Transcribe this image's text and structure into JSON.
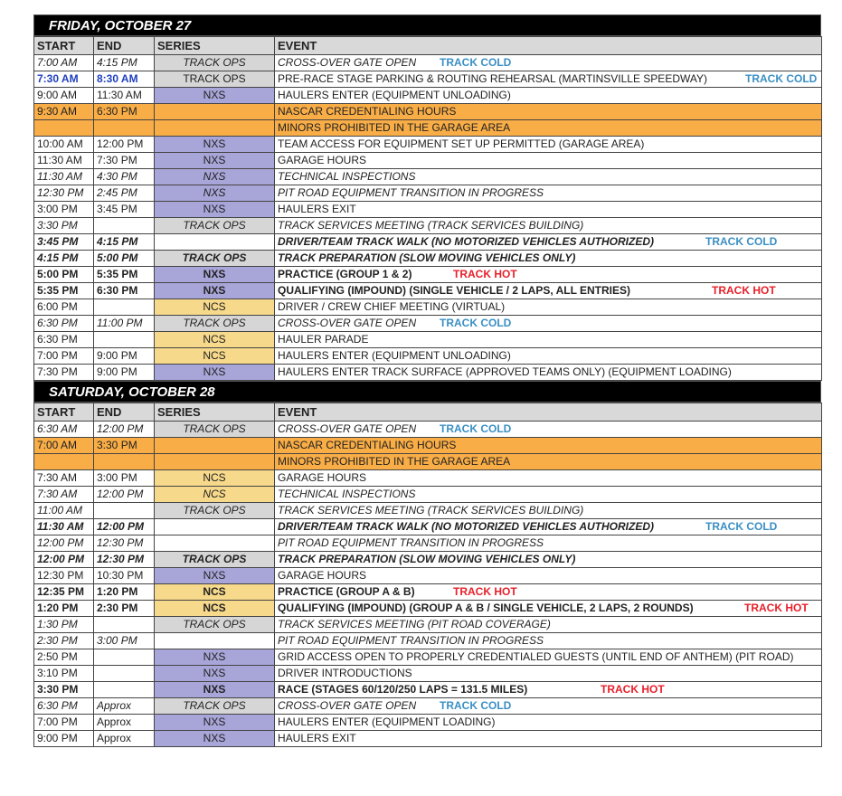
{
  "columns": {
    "start": "START",
    "end": "END",
    "series": "SERIES",
    "event": "EVENT"
  },
  "colors": {
    "track_cold": "#3a8fc4",
    "track_hot": "#e8202a",
    "credential_orange": "#f9ad46",
    "track_ops_gray": "#d6d6d6",
    "nxs_purple": "#a8a5d8",
    "ncs_yellow": "#f7d98b",
    "header_black": "#000000"
  },
  "days": [
    {
      "title": "FRIDAY, OCTOBER 27",
      "rows": [
        {
          "start": "7:00 AM",
          "end": "4:15 PM",
          "series": "TRACK OPS",
          "event": "CROSS-OVER GATE OPEN",
          "tag": "TRACK COLD",
          "tag_offset": 182,
          "style": "italic"
        },
        {
          "start": "7:30 AM",
          "end": "8:30 AM",
          "series": "TRACK OPS",
          "event": "PRE-RACE STAGE PARKING & ROUTING REHEARSAL  (MARTINSVILLE SPEEDWAY)",
          "tag": "TRACK COLD",
          "tag_offset": 520,
          "style": "blue"
        },
        {
          "start": "9:00 AM",
          "end": "11:30 AM",
          "series": "NXS",
          "event": "HAULERS ENTER (EQUIPMENT UNLOADING)",
          "tag": "",
          "style": ""
        },
        {
          "start": "9:30 AM",
          "end": "6:30 PM",
          "series": "",
          "event": "NASCAR CREDENTIALING HOURS",
          "tag": "",
          "style": "orange"
        },
        {
          "start": "",
          "end": "",
          "series": "",
          "event": "MINORS PROHIBITED IN THE GARAGE AREA",
          "tag": "",
          "style": "orange"
        },
        {
          "start": "10:00 AM",
          "end": "12:00 PM",
          "series": "NXS",
          "event": "TEAM ACCESS FOR EQUIPMENT SET UP PERMITTED (GARAGE AREA)",
          "tag": "",
          "style": ""
        },
        {
          "start": "11:30 AM",
          "end": "7:30 PM",
          "series": "NXS",
          "event": "GARAGE HOURS",
          "tag": "",
          "style": ""
        },
        {
          "start": "11:30 AM",
          "end": "4:30 PM",
          "series": "NXS",
          "event": "TECHNICAL INSPECTIONS",
          "tag": "",
          "style": "italic"
        },
        {
          "start": "12:30 PM",
          "end": "2:45 PM",
          "series": "NXS",
          "event": "PIT ROAD EQUIPMENT TRANSITION IN PROGRESS",
          "tag": "",
          "style": "italic"
        },
        {
          "start": "3:00 PM",
          "end": "3:45 PM",
          "series": "NXS",
          "event": "HAULERS EXIT",
          "tag": "",
          "style": ""
        },
        {
          "start": "3:30 PM",
          "end": "",
          "series": "TRACK OPS",
          "event": "TRACK SERVICES MEETING (TRACK SERVICES BUILDING)",
          "tag": "",
          "style": "italic"
        },
        {
          "start": "3:45 PM",
          "end": "4:15 PM",
          "series": "",
          "event": "DRIVER/TEAM TRACK WALK  (NO MOTORIZED VEHICLES AUTHORIZED)",
          "tag": "TRACK COLD",
          "tag_offset": 476,
          "style": "bold italic"
        },
        {
          "start": "4:15 PM",
          "end": "5:00 PM",
          "series": "TRACK OPS",
          "event": "TRACK PREPARATION  (SLOW MOVING VEHICLES ONLY)",
          "tag": "",
          "style": "bold italic"
        },
        {
          "start": "5:00 PM",
          "end": "5:35 PM",
          "series": "NXS",
          "event": "PRACTICE (GROUP 1 & 2)",
          "tag": "TRACK HOT",
          "tag_offset": 197,
          "style": "bold"
        },
        {
          "start": "5:35 PM",
          "end": "6:30 PM",
          "series": "NXS",
          "event": "QUALIFYING (IMPOUND) (SINGLE VEHICLE / 2 LAPS, ALL ENTRIES)",
          "tag": "TRACK HOT",
          "tag_offset": 483,
          "style": "bold"
        },
        {
          "start": "6:00 PM",
          "end": "",
          "series": "NCS",
          "event": "DRIVER / CREW CHIEF MEETING (VIRTUAL)",
          "tag": "",
          "style": ""
        },
        {
          "start": "6:30 PM",
          "end": "11:00 PM",
          "series": "TRACK OPS",
          "event": "CROSS-OVER GATE OPEN",
          "tag": "TRACK COLD",
          "tag_offset": 182,
          "style": "italic"
        },
        {
          "start": "6:30 PM",
          "end": "",
          "series": "NCS",
          "event": "HAULER PARADE",
          "tag": "",
          "style": ""
        },
        {
          "start": "7:00 PM",
          "end": "9:00 PM",
          "series": "NCS",
          "event": "HAULERS ENTER (EQUIPMENT UNLOADING)",
          "tag": "",
          "style": ""
        },
        {
          "start": "7:30 PM",
          "end": "9:00 PM",
          "series": "NXS",
          "event": "HAULERS ENTER TRACK SURFACE (APPROVED TEAMS ONLY) (EQUIPMENT LOADING)",
          "tag": "",
          "style": ""
        }
      ]
    },
    {
      "title": "SATURDAY, OCTOBER 28",
      "rows": [
        {
          "start": "6:30 AM",
          "end": "12:00 PM",
          "series": "TRACK OPS",
          "event": "CROSS-OVER GATE OPEN",
          "tag": "TRACK COLD",
          "tag_offset": 182,
          "style": "italic"
        },
        {
          "start": "7:00 AM",
          "end": "3:30 PM",
          "series": "",
          "event": "NASCAR CREDENTIALING HOURS",
          "tag": "",
          "style": "orange"
        },
        {
          "start": "",
          "end": "",
          "series": "",
          "event": "MINORS PROHIBITED IN THE GARAGE AREA",
          "tag": "",
          "style": "orange"
        },
        {
          "start": "7:30 AM",
          "end": "3:00 PM",
          "series": "NCS",
          "event": "GARAGE HOURS",
          "tag": "",
          "style": ""
        },
        {
          "start": "7:30 AM",
          "end": "12:00 PM",
          "series": "NCS",
          "event": "TECHNICAL INSPECTIONS",
          "tag": "",
          "style": "italic"
        },
        {
          "start": "11:00 AM",
          "end": "",
          "series": "TRACK OPS",
          "event": "TRACK SERVICES MEETING (TRACK SERVICES BUILDING)",
          "tag": "",
          "style": "italic"
        },
        {
          "start": "11:30 AM",
          "end": "12:00 PM",
          "series": "",
          "event": "DRIVER/TEAM TRACK WALK  (NO MOTORIZED VEHICLES AUTHORIZED)",
          "tag": "TRACK COLD",
          "tag_offset": 476,
          "style": "bold italic"
        },
        {
          "start": "12:00 PM",
          "end": "12:30 PM",
          "series": "",
          "event": "PIT ROAD EQUIPMENT TRANSITION IN PROGRESS",
          "tag": "",
          "style": "italic"
        },
        {
          "start": "12:00 PM",
          "end": "12:30 PM",
          "series": "TRACK OPS",
          "event": "TRACK PREPARATION  (SLOW MOVING VEHICLES ONLY)",
          "tag": "",
          "style": "bold italic"
        },
        {
          "start": "12:30 PM",
          "end": "10:30 PM",
          "series": "NXS",
          "event": "GARAGE HOURS",
          "tag": "",
          "style": ""
        },
        {
          "start": "12:35 PM",
          "end": "1:20 PM",
          "series": "NCS",
          "event": "PRACTICE (GROUP A & B)",
          "tag": "TRACK HOT",
          "tag_offset": 197,
          "style": "bold"
        },
        {
          "start": "1:20 PM",
          "end": "2:30 PM",
          "series": "NCS",
          "event": "QUALIFYING (IMPOUND) (GROUP A & B / SINGLE VEHICLE, 2 LAPS, 2 ROUNDS)",
          "tag": "TRACK HOT",
          "tag_offset": 519,
          "style": "bold"
        },
        {
          "start": "1:30 PM",
          "end": "",
          "series": "TRACK OPS",
          "event": "TRACK SERVICES MEETING (PIT ROAD COVERAGE)",
          "tag": "",
          "style": "italic"
        },
        {
          "start": "2:30 PM",
          "end": "3:00 PM",
          "series": "",
          "event": "PIT ROAD EQUIPMENT TRANSITION IN PROGRESS",
          "tag": "",
          "style": "italic"
        },
        {
          "start": "2:50 PM",
          "end": "",
          "series": "NXS",
          "event": "GRID ACCESS OPEN TO PROPERLY CREDENTIALED GUESTS (UNTIL END OF ANTHEM) (PIT ROAD)",
          "tag": "",
          "style": ""
        },
        {
          "start": "3:10 PM",
          "end": "",
          "series": "NXS",
          "event": "DRIVER INTRODUCTIONS",
          "tag": "",
          "style": ""
        },
        {
          "start": "3:30 PM",
          "end": "",
          "series": "NXS",
          "event": "RACE (STAGES 60/120/250 LAPS = 131.5 MILES)",
          "tag": "TRACK HOT",
          "tag_offset": 360,
          "style": "bold"
        },
        {
          "start": "6:30 PM",
          "end": "Approx",
          "series": "TRACK OPS",
          "event": "CROSS-OVER GATE OPEN",
          "tag": "TRACK COLD",
          "tag_offset": 182,
          "style": "italic"
        },
        {
          "start": "7:00 PM",
          "end": "Approx",
          "series": "NXS",
          "event": "HAULERS ENTER (EQUIPMENT LOADING)",
          "tag": "",
          "style": ""
        },
        {
          "start": "9:00 PM",
          "end": "Approx",
          "series": "NXS",
          "event": "HAULERS EXIT",
          "tag": "",
          "style": ""
        }
      ]
    }
  ]
}
